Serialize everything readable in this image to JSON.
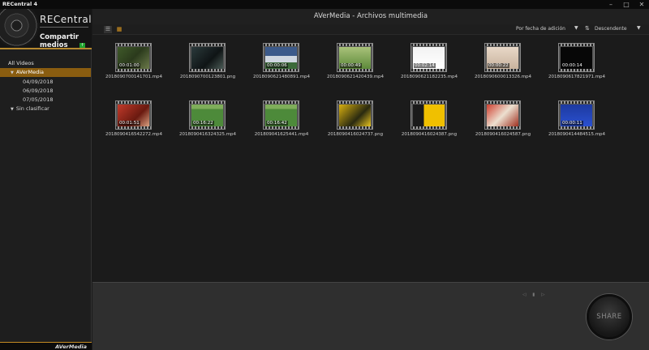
{
  "window": {
    "title": "RECentral 4"
  },
  "brand": {
    "logo": "RECentral",
    "share_media": "Compartir medios"
  },
  "main": {
    "title": "AVerMedia - Archivos multimedia"
  },
  "toolbar": {
    "sort_field": "Por fecha de adición",
    "sort_order": "Descendente"
  },
  "tree": {
    "header": "All Videos",
    "items": [
      {
        "label": "AVerMedia",
        "level": 1,
        "selected": true,
        "expanded": true
      },
      {
        "label": "04/09/2018",
        "level": 2,
        "selected": false
      },
      {
        "label": "06/09/2018",
        "level": 2,
        "selected": false
      },
      {
        "label": "07/05/2018",
        "level": 2,
        "selected": false
      },
      {
        "label": "Sin clasificar",
        "level": 1,
        "selected": false,
        "expanded": true
      }
    ]
  },
  "files": [
    {
      "name": "20180907001417​01.mp4",
      "duration": "00:01:00",
      "scene": "forest"
    },
    {
      "name": "20180907001238​01.png",
      "duration": "",
      "scene": "dark"
    },
    {
      "name": "20180906214808​91.mp4",
      "duration": "00:00:06",
      "scene": "blue-ui"
    },
    {
      "name": "20180906214204​39.mp4",
      "duration": "00:00:49",
      "scene": "grass"
    },
    {
      "name": "20180906211822​35.mp4",
      "duration": "00:02:14",
      "scene": "doc"
    },
    {
      "name": "20180906000133​26.mp4",
      "duration": "00:00:22",
      "scene": "beige"
    },
    {
      "name": "20180906178219​71.mp4",
      "duration": "00:00:14",
      "scene": "black"
    },
    {
      "name": "20180904165422​72.mp4",
      "duration": "00:01:51",
      "scene": "red"
    },
    {
      "name": "20180904163243​25.mp4",
      "duration": "00:16:22",
      "scene": "field"
    },
    {
      "name": "20180904162544​1.mp4",
      "duration": "00:16:42",
      "scene": "field"
    },
    {
      "name": "20180904160247​37.png",
      "duration": "",
      "scene": "yellow"
    },
    {
      "name": "20180904160243​87.png",
      "duration": "",
      "scene": "yellow-a"
    },
    {
      "name": "20180904160245​87.png",
      "duration": "",
      "scene": "red2"
    },
    {
      "name": "20180904144845​15.mp4",
      "duration": "00:00:11",
      "scene": "blue-screen"
    }
  ],
  "share": {
    "label": "SHARE"
  },
  "footer": {
    "logo": "AVerMedia"
  },
  "colors": {
    "accent": "#b5882f",
    "selected": "#8a5d10",
    "share_green": "#1ea12e"
  }
}
